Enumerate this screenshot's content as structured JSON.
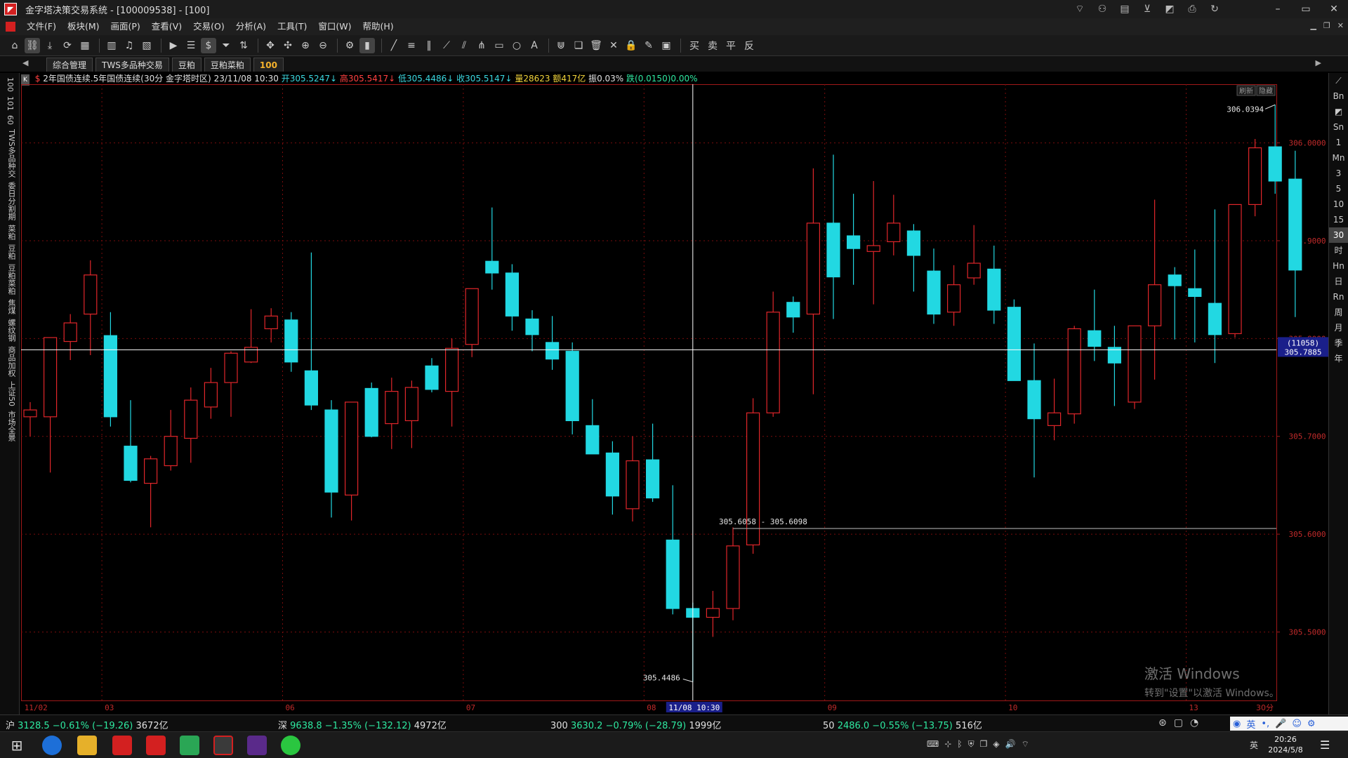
{
  "window": {
    "title": "金字塔决策交易系统 - [100009538] - [100]",
    "icons": [
      "rss-icon",
      "user-icon",
      "document-icon",
      "cart-icon",
      "chart-icon",
      "print-icon",
      "refresh-icon"
    ],
    "controls": [
      "–",
      "▭",
      "✕"
    ]
  },
  "menu": {
    "items": [
      "文件(F)",
      "板块(M)",
      "画面(P)",
      "查看(V)",
      "交易(O)",
      "分析(A)",
      "工具(T)",
      "窗口(W)",
      "帮助(H)"
    ]
  },
  "toolbar": {
    "dollar": "$",
    "trade": [
      "买",
      "卖",
      "平",
      "反"
    ]
  },
  "tabs": {
    "items": [
      "综合管理",
      "TWS多品种交易",
      "豆粕",
      "豆粕菜粕",
      "100"
    ],
    "active_index": 4
  },
  "left_strip": [
    "100",
    "101",
    "60",
    "TWS多品种交",
    "委日分割期",
    "菜粕",
    "豆粕",
    "豆粕菜粕",
    "焦煤",
    "螺纹钢",
    "商品加权",
    "上证50",
    "市场全景"
  ],
  "right_strip": [
    "Bn",
    "Sn",
    "1",
    "Mn",
    "3",
    "5",
    "10",
    "15",
    "30",
    "时",
    "Hn",
    "日",
    "Rn",
    "周",
    "月",
    "季",
    "年"
  ],
  "right_strip_active": "30",
  "info": {
    "badge": "K",
    "marker": "$",
    "title": "2年国债连续.5年国债连续(30分 金字塔时区)",
    "datetime": "23/11/08 10:30",
    "open": "开305.5247↓",
    "high": "高305.5417↓",
    "low": "低305.4486↓",
    "close": "收305.5147↓",
    "vol": "量28623",
    "amount": "额417亿",
    "amplitude": "振0.03%",
    "change": "跌(0.0150)0.00%"
  },
  "chart_data": {
    "type": "candlestick",
    "symbol": "2年国债连续.5年国债连续",
    "period": "30分",
    "ylim": [
      305.43,
      306.06
    ],
    "yticks": [
      "306.0000",
      "305.9000",
      "305.8000",
      "305.7000",
      "305.6000",
      "305.5000"
    ],
    "ytick_values": [
      306.0,
      305.9,
      305.8,
      305.7,
      305.6,
      305.5
    ],
    "xticks": [
      "11/02",
      "03",
      "06",
      "07",
      "08",
      "09",
      "10",
      "13"
    ],
    "xtick_index": [
      0,
      4,
      13,
      22,
      31,
      40,
      49,
      58
    ],
    "x_tail": "30分",
    "candles": [
      {
        "o": 305.72,
        "h": 305.735,
        "l": 305.7,
        "c": 305.727
      },
      {
        "o": 305.72,
        "h": 305.792,
        "l": 305.663,
        "c": 305.801
      },
      {
        "o": 305.797,
        "h": 305.825,
        "l": 305.778,
        "c": 305.816
      },
      {
        "o": 305.825,
        "h": 305.88,
        "l": 305.783,
        "c": 305.865
      },
      {
        "o": 305.803,
        "h": 305.827,
        "l": 305.71,
        "c": 305.72
      },
      {
        "o": 305.69,
        "h": 305.737,
        "l": 305.653,
        "c": 305.655
      },
      {
        "o": 305.652,
        "h": 305.68,
        "l": 305.607,
        "c": 305.677
      },
      {
        "o": 305.67,
        "h": 305.727,
        "l": 305.665,
        "c": 305.7
      },
      {
        "o": 305.698,
        "h": 305.75,
        "l": 305.673,
        "c": 305.737
      },
      {
        "o": 305.73,
        "h": 305.77,
        "l": 305.718,
        "c": 305.755
      },
      {
        "o": 305.755,
        "h": 305.787,
        "l": 305.72,
        "c": 305.785
      },
      {
        "o": 305.776,
        "h": 305.83,
        "l": 305.775,
        "c": 305.791
      },
      {
        "o": 305.81,
        "h": 305.831,
        "l": 305.796,
        "c": 305.823
      },
      {
        "o": 305.819,
        "h": 305.827,
        "l": 305.766,
        "c": 305.776
      },
      {
        "o": 305.767,
        "h": 305.888,
        "l": 305.727,
        "c": 305.732
      },
      {
        "o": 305.727,
        "h": 305.737,
        "l": 305.617,
        "c": 305.643
      },
      {
        "o": 305.64,
        "h": 305.735,
        "l": 305.614,
        "c": 305.735
      },
      {
        "o": 305.749,
        "h": 305.755,
        "l": 305.699,
        "c": 305.7
      },
      {
        "o": 305.713,
        "h": 305.76,
        "l": 305.687,
        "c": 305.746
      },
      {
        "o": 305.716,
        "h": 305.757,
        "l": 305.688,
        "c": 305.75
      },
      {
        "o": 305.772,
        "h": 305.78,
        "l": 305.745,
        "c": 305.748
      },
      {
        "o": 305.746,
        "h": 305.8,
        "l": 305.71,
        "c": 305.79
      },
      {
        "o": 305.794,
        "h": 305.835,
        "l": 305.781,
        "c": 305.851
      },
      {
        "o": 305.879,
        "h": 305.934,
        "l": 305.85,
        "c": 305.867
      },
      {
        "o": 305.867,
        "h": 305.876,
        "l": 305.808,
        "c": 305.823
      },
      {
        "o": 305.82,
        "h": 305.829,
        "l": 305.787,
        "c": 305.804
      },
      {
        "o": 305.796,
        "h": 305.823,
        "l": 305.768,
        "c": 305.779
      },
      {
        "o": 305.787,
        "h": 305.796,
        "l": 305.702,
        "c": 305.716
      },
      {
        "o": 305.711,
        "h": 305.738,
        "l": 305.69,
        "c": 305.682
      },
      {
        "o": 305.683,
        "h": 305.695,
        "l": 305.62,
        "c": 305.639
      },
      {
        "o": 305.626,
        "h": 305.7,
        "l": 305.613,
        "c": 305.675
      },
      {
        "o": 305.676,
        "h": 305.713,
        "l": 305.633,
        "c": 305.637
      },
      {
        "o": 305.594,
        "h": 305.65,
        "l": 305.518,
        "c": 305.524
      },
      {
        "o": 305.524,
        "h": 305.53,
        "l": 305.449,
        "c": 305.515
      },
      {
        "o": 305.515,
        "h": 305.542,
        "l": 305.495,
        "c": 305.524
      },
      {
        "o": 305.524,
        "h": 305.607,
        "l": 305.512,
        "c": 305.588
      },
      {
        "o": 305.589,
        "h": 305.739,
        "l": 305.58,
        "c": 305.724
      },
      {
        "o": 305.724,
        "h": 305.848,
        "l": 305.72,
        "c": 305.827
      },
      {
        "o": 305.837,
        "h": 305.843,
        "l": 305.806,
        "c": 305.822
      },
      {
        "o": 305.825,
        "h": 305.974,
        "l": 305.743,
        "c": 305.918
      },
      {
        "o": 305.918,
        "h": 305.988,
        "l": 305.82,
        "c": 305.863
      },
      {
        "o": 305.905,
        "h": 305.948,
        "l": 305.855,
        "c": 305.892
      },
      {
        "o": 305.889,
        "h": 305.961,
        "l": 305.835,
        "c": 305.895
      },
      {
        "o": 305.899,
        "h": 305.947,
        "l": 305.885,
        "c": 305.918
      },
      {
        "o": 305.91,
        "h": 305.917,
        "l": 305.848,
        "c": 305.885
      },
      {
        "o": 305.869,
        "h": 305.892,
        "l": 305.815,
        "c": 305.825
      },
      {
        "o": 305.827,
        "h": 305.875,
        "l": 305.813,
        "c": 305.855
      },
      {
        "o": 305.862,
        "h": 305.916,
        "l": 305.855,
        "c": 305.877
      },
      {
        "o": 305.871,
        "h": 305.895,
        "l": 305.815,
        "c": 305.829
      },
      {
        "o": 305.832,
        "h": 305.84,
        "l": 305.76,
        "c": 305.757
      },
      {
        "o": 305.757,
        "h": 305.795,
        "l": 305.658,
        "c": 305.718
      },
      {
        "o": 305.711,
        "h": 305.759,
        "l": 305.696,
        "c": 305.724
      },
      {
        "o": 305.723,
        "h": 305.813,
        "l": 305.713,
        "c": 305.81
      },
      {
        "o": 305.808,
        "h": 305.85,
        "l": 305.777,
        "c": 305.792
      },
      {
        "o": 305.791,
        "h": 305.813,
        "l": 305.731,
        "c": 305.775
      },
      {
        "o": 305.735,
        "h": 305.812,
        "l": 305.728,
        "c": 305.813
      },
      {
        "o": 305.813,
        "h": 305.942,
        "l": 305.758,
        "c": 305.855
      },
      {
        "o": 305.865,
        "h": 305.873,
        "l": 305.799,
        "c": 305.854
      },
      {
        "o": 305.851,
        "h": 305.891,
        "l": 305.796,
        "c": 305.843
      },
      {
        "o": 305.836,
        "h": 305.932,
        "l": 305.775,
        "c": 305.804
      },
      {
        "o": 305.805,
        "h": 305.93,
        "l": 305.801,
        "c": 305.937
      },
      {
        "o": 305.937,
        "h": 306.004,
        "l": 305.925,
        "c": 305.995
      },
      {
        "o": 305.996,
        "h": 306.039,
        "l": 305.948,
        "c": 305.961
      },
      {
        "o": 305.963,
        "h": 305.992,
        "l": 305.822,
        "c": 305.87
      }
    ],
    "up_color": "#e0262a",
    "down_color": "#22d8e2",
    "crosshair": {
      "index": 33,
      "price": 305.7885,
      "label_count": "(11058)",
      "label_price": "305.7885",
      "x_label": "11/08 10:30"
    },
    "hline": {
      "price": 305.6058,
      "start_index": 35,
      "label": "305.6058 - 305.6098"
    },
    "annotations": {
      "max_label": "306.0394",
      "max_index": 62,
      "min_label": "305.4486",
      "min_index": 33
    },
    "corner_buttons": [
      "刷新",
      "隐藏"
    ]
  },
  "status": {
    "sh": {
      "name": "沪",
      "value": "3128.5 −0.61% (−19.26)",
      "amount": "3672亿"
    },
    "sz": {
      "name": "深",
      "value": "9638.8 −1.35% (−132.12)",
      "amount": "4972亿"
    },
    "i300": {
      "name": "300",
      "value": "3630.2 −0.79% (−28.79)",
      "amount": "1999亿"
    },
    "i50": {
      "name": "50",
      "value": "2486.0 −0.55% (−13.75)",
      "amount": "516亿"
    },
    "ime_lang": "英"
  },
  "taskbar": {
    "time": "20:26",
    "date": "2024/5/8",
    "ime": "英"
  },
  "watermark": {
    "line1": "激活 Windows",
    "line2": "转到\"设置\"以激活 Windows。"
  },
  "colors": {
    "grid": "#7a0c0c",
    "axis": "#a01818",
    "price_label": "#c02a2a",
    "crosshair": "#ffffff",
    "text_up": "#ff4040",
    "text_down": "#3ad8e0"
  }
}
